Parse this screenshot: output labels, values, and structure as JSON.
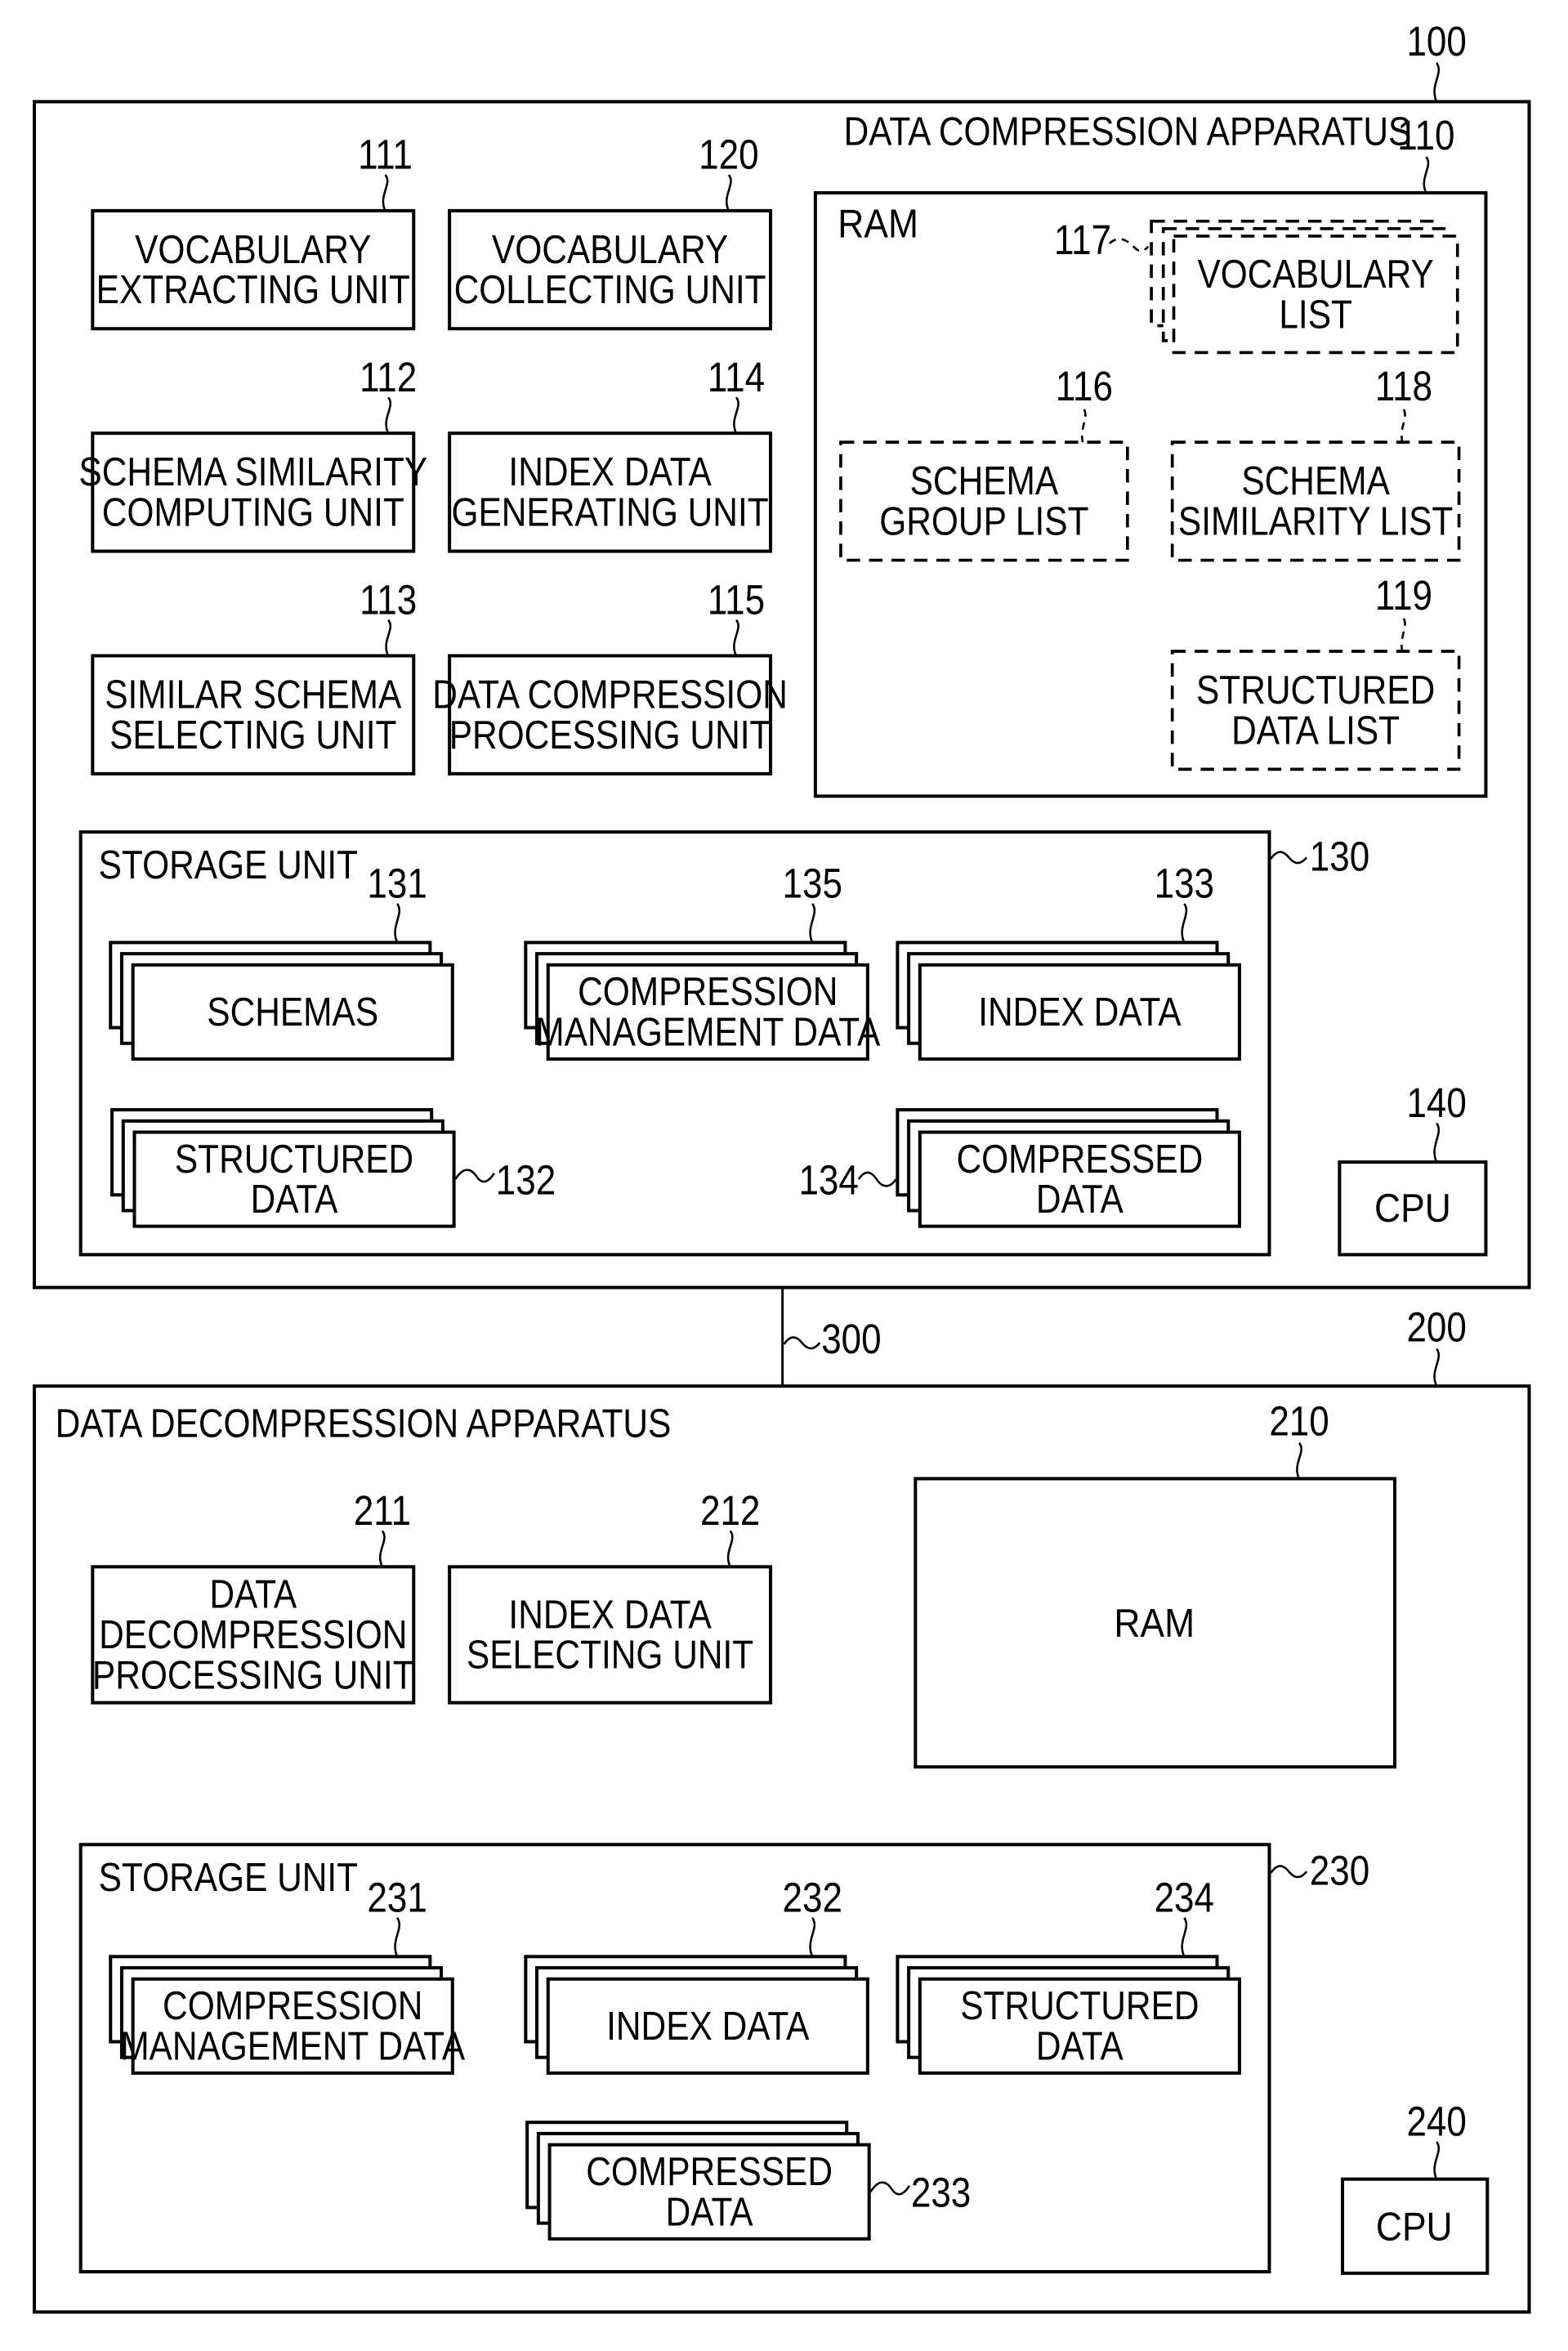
{
  "compression_apparatus": {
    "ref": "100",
    "title": "DATA COMPRESSION APPARATUS",
    "units": [
      {
        "ref": "111",
        "lines": [
          "VOCABULARY",
          "EXTRACTING UNIT"
        ]
      },
      {
        "ref": "120",
        "lines": [
          "VOCABULARY",
          "COLLECTING UNIT"
        ]
      },
      {
        "ref": "112",
        "lines": [
          "SCHEMA SIMILARITY",
          "COMPUTING UNIT"
        ]
      },
      {
        "ref": "114",
        "lines": [
          "INDEX DATA",
          "GENERATING UNIT"
        ]
      },
      {
        "ref": "113",
        "lines": [
          "SIMILAR SCHEMA",
          "SELECTING UNIT"
        ]
      },
      {
        "ref": "115",
        "lines": [
          "DATA COMPRESSION",
          "PROCESSING UNIT"
        ]
      }
    ],
    "ram": {
      "ref": "110",
      "title": "RAM",
      "lists": [
        {
          "ref": "117",
          "lines": [
            "VOCABULARY",
            "LIST"
          ]
        },
        {
          "ref": "116",
          "lines": [
            "SCHEMA",
            "GROUP LIST"
          ]
        },
        {
          "ref": "118",
          "lines": [
            "SCHEMA",
            "SIMILARITY LIST"
          ]
        },
        {
          "ref": "119",
          "lines": [
            "STRUCTURED",
            "DATA LIST"
          ]
        }
      ]
    },
    "storage": {
      "ref": "130",
      "title": "STORAGE UNIT",
      "items": [
        {
          "ref": "131",
          "lines": [
            "SCHEMAS"
          ]
        },
        {
          "ref": "135",
          "lines": [
            "COMPRESSION",
            "MANAGEMENT DATA"
          ]
        },
        {
          "ref": "133",
          "lines": [
            "INDEX DATA"
          ]
        },
        {
          "ref": "132",
          "lines": [
            "STRUCTURED",
            "DATA"
          ]
        },
        {
          "ref": "134",
          "lines": [
            "COMPRESSED",
            "DATA"
          ]
        }
      ]
    },
    "cpu": {
      "ref": "140",
      "label": "CPU"
    }
  },
  "network": {
    "ref": "300"
  },
  "decompression_apparatus": {
    "ref": "200",
    "title": "DATA DECOMPRESSION APPARATUS",
    "units": [
      {
        "ref": "211",
        "lines": [
          "DATA",
          "DECOMPRESSION",
          "PROCESSING UNIT"
        ]
      },
      {
        "ref": "212",
        "lines": [
          "INDEX DATA",
          "SELECTING UNIT"
        ]
      }
    ],
    "ram": {
      "ref": "210",
      "label": "RAM"
    },
    "storage": {
      "ref": "230",
      "title": "STORAGE UNIT",
      "items": [
        {
          "ref": "231",
          "lines": [
            "COMPRESSION",
            "MANAGEMENT DATA"
          ]
        },
        {
          "ref": "232",
          "lines": [
            "INDEX DATA"
          ]
        },
        {
          "ref": "234",
          "lines": [
            "STRUCTURED",
            "DATA"
          ]
        },
        {
          "ref": "233",
          "lines": [
            "COMPRESSED",
            "DATA"
          ]
        }
      ]
    },
    "cpu": {
      "ref": "240",
      "label": "CPU"
    }
  }
}
